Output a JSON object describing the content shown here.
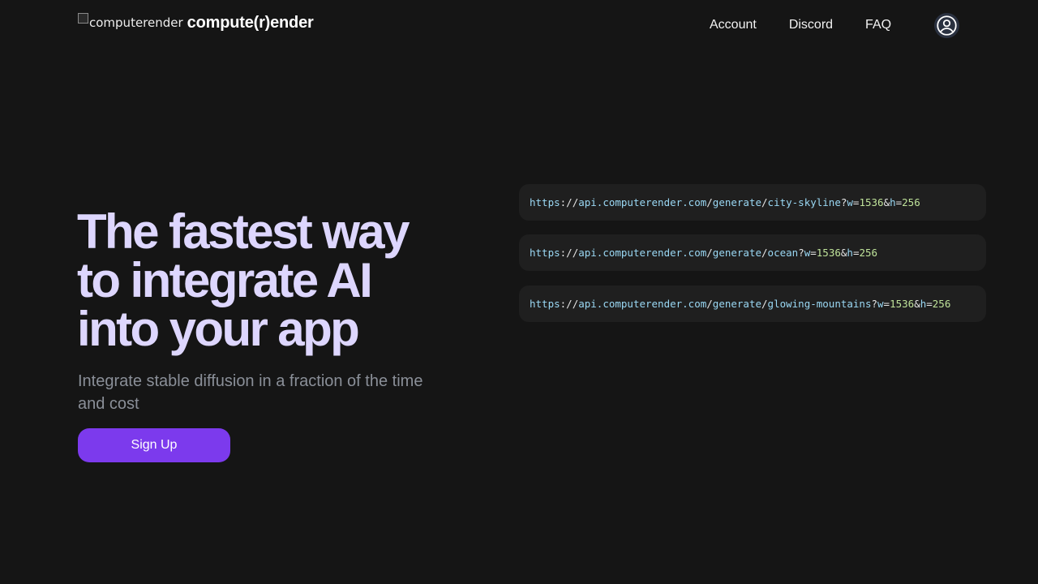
{
  "brand": {
    "logo_alt": "computerender",
    "name": "compute(r)ender"
  },
  "nav": {
    "items": [
      {
        "label": "Account"
      },
      {
        "label": "Discord"
      },
      {
        "label": "FAQ"
      }
    ],
    "account_icon": "user-circle-icon"
  },
  "hero": {
    "title_lines": [
      "The fastest way",
      "to integrate AI",
      "into your app"
    ],
    "subtitle": "Integrate stable diffusion in a fraction of the time and cost",
    "cta_label": "Sign Up"
  },
  "examples": [
    {
      "scheme": "https",
      "host": "api.computerender.com",
      "path_prefix": "generate",
      "prompt": "city-skyline",
      "w_key": "w",
      "w_value": "1536",
      "h_key": "h",
      "h_value": "256"
    },
    {
      "scheme": "https",
      "host": "api.computerender.com",
      "path_prefix": "generate",
      "prompt": "ocean",
      "w_key": "w",
      "w_value": "1536",
      "h_key": "h",
      "h_value": "256"
    },
    {
      "scheme": "https",
      "host": "api.computerender.com",
      "path_prefix": "generate",
      "prompt": "glowing-mountains",
      "w_key": "w",
      "w_value": "1536",
      "h_key": "h",
      "h_value": "256"
    }
  ],
  "colors": {
    "background": "#151515",
    "accent": "#7c3aed",
    "title": "#ddd6fe",
    "code_url": "#9ad8f4",
    "code_number": "#bfe39a"
  }
}
